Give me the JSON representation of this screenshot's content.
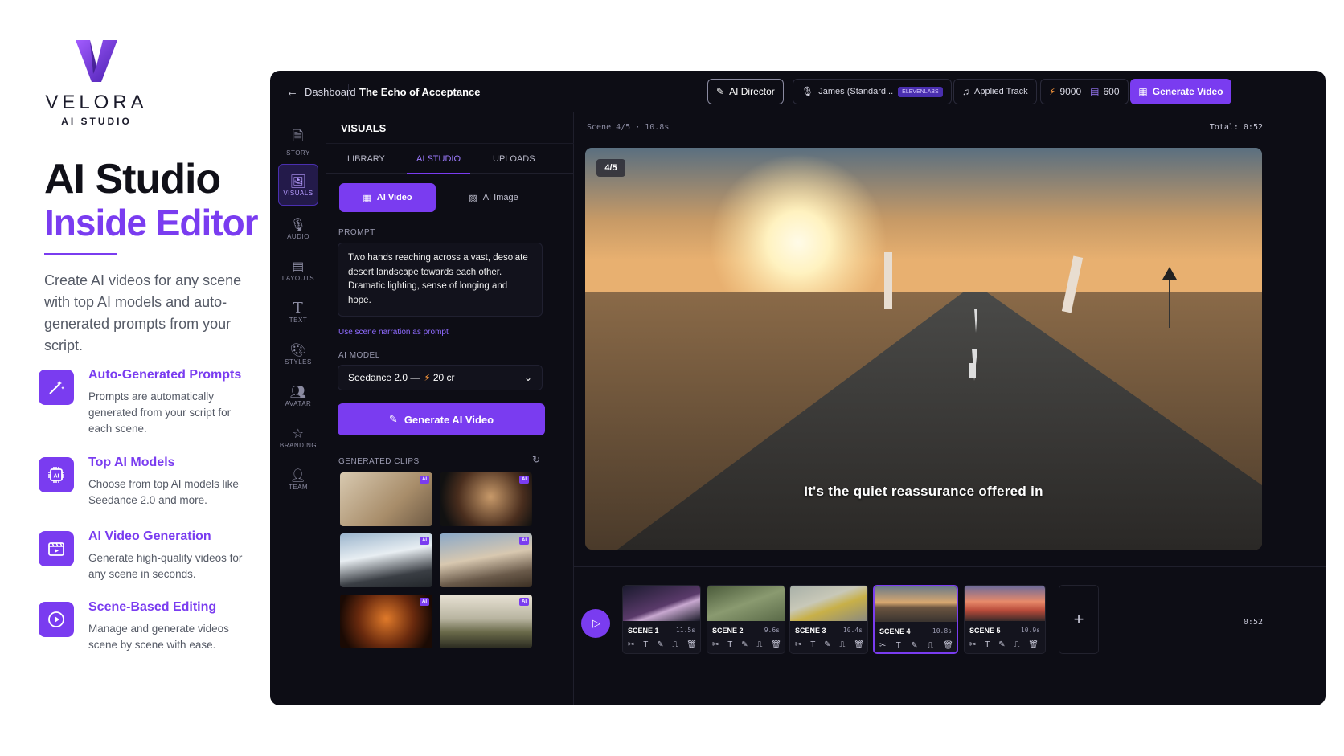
{
  "brand": {
    "name": "VELORA",
    "sub": "AI STUDIO"
  },
  "hero": {
    "line1": "AI Studio",
    "line2": "Inside Editor",
    "desc": "Create AI videos for any scene with top AI models and auto-generated prompts from your script."
  },
  "features": [
    {
      "title": "Auto-Generated Prompts",
      "desc": "Prompts are automatically generated from your script for each scene.",
      "icon": "magic-wand-icon"
    },
    {
      "title": "Top AI Models",
      "desc": "Choose from top AI models like Seedance 2.0 and more.",
      "icon": "ai-chip-icon"
    },
    {
      "title": "AI Video Generation",
      "desc": "Generate high-quality videos for any scene in seconds.",
      "icon": "video-clapper-icon"
    },
    {
      "title": "Scene-Based Editing",
      "desc": "Manage and generate videos scene by scene with ease.",
      "icon": "play-circle-icon"
    }
  ],
  "topbar": {
    "back": "Dashboard",
    "project": "The Echo of Acceptance",
    "director": "AI Director",
    "voice": "James (Standard...",
    "voice_badge": "ELEVENLABS",
    "track": "Applied Track",
    "credits1": "9000",
    "credits2": "600",
    "generate": "Generate Video"
  },
  "sidebar": [
    "STORY",
    "VISUALS",
    "AUDIO",
    "LAYOUTS",
    "TEXT",
    "STYLES",
    "AVATAR",
    "BRANDING",
    "TEAM"
  ],
  "panel": {
    "title": "VISUALS",
    "tabs": [
      "LIBRARY",
      "AI STUDIO",
      "UPLOADS"
    ],
    "seg_video": "AI Video",
    "seg_image": "AI Image",
    "prompt_label": "PROMPT",
    "prompt": "Two hands reaching across a vast, desolate desert landscape towards each other. Dramatic lighting, sense of longing and hope.",
    "use_scene": "Use scene narration as prompt",
    "model_label": "AI MODEL",
    "model": "Seedance 2.0 —",
    "model_cost": "20 cr",
    "generate": "Generate AI Video",
    "clips_label": "GENERATED CLIPS",
    "ai_badge": "AI"
  },
  "main": {
    "scene_info": "Scene 4/5 · 10.8s",
    "total": "Total: 0:52",
    "badge": "4/5",
    "caption": "It's the quiet reassurance offered in",
    "time": "0:52"
  },
  "scenes": [
    {
      "name": "SCENE 1",
      "dur": "11.5s"
    },
    {
      "name": "SCENE 2",
      "dur": "9.6s"
    },
    {
      "name": "SCENE 3",
      "dur": "10.4s"
    },
    {
      "name": "SCENE 4",
      "dur": "10.8s"
    },
    {
      "name": "SCENE 5",
      "dur": "10.9s"
    }
  ],
  "colors": {
    "accent": "#7a3cf0",
    "bg": "#0d0d15"
  }
}
